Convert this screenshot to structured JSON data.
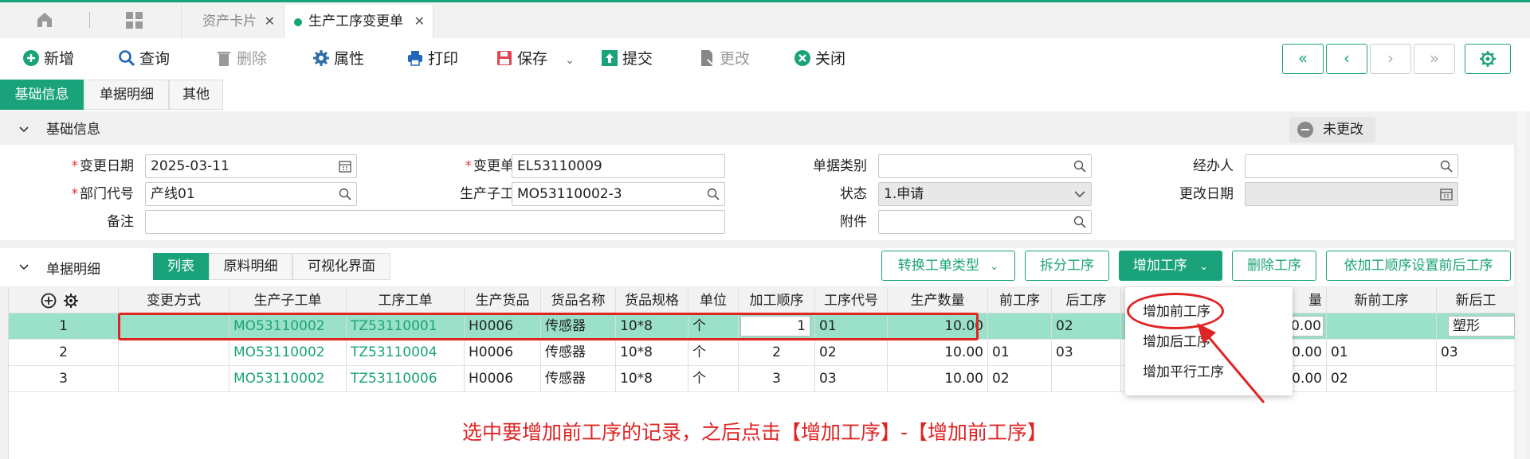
{
  "top_tabs": [
    {
      "label": "资产卡片"
    },
    {
      "label": "生产工序变更单"
    }
  ],
  "toolbar": {
    "add": "新增",
    "query": "查询",
    "delete": "删除",
    "properties": "属性",
    "print": "打印",
    "save": "保存",
    "submit": "提交",
    "modify": "更改",
    "close": "关闭"
  },
  "nav": {
    "first": "«",
    "prev": "‹",
    "next": "›",
    "last": "»"
  },
  "section_tabs": [
    "基础信息",
    "单据明细",
    "其他"
  ],
  "basic": {
    "title": "基础信息",
    "status": "未更改",
    "fields": {
      "change_date_label": "变更日期",
      "change_date": "2025-03-11",
      "change_no_label": "变更单号",
      "change_no": "EL53110009",
      "doc_type_label": "单据类别",
      "doc_type": "",
      "handler_label": "经办人",
      "handler": "",
      "dept_label": "部门代号",
      "dept": "产线01",
      "sub_order_label": "生产子工单",
      "sub_order": "MO53110002-3",
      "state_label": "状态",
      "state": "1.申请",
      "change_time_label": "更改日期",
      "change_time": "",
      "remark_label": "备注",
      "remark": "",
      "attachment_label": "附件",
      "attachment": ""
    },
    "required_mark": "*"
  },
  "detail": {
    "title": "单据明细",
    "tabs": [
      "列表",
      "原料明细",
      "可视化界面"
    ],
    "actions": {
      "convert": "转换工单类型",
      "split": "拆分工序",
      "add": "增加工序",
      "remove": "删除工序",
      "set_by_order": "依加工顺序设置前后工序"
    },
    "columns": [
      "变更方式",
      "生产子工单",
      "工序工单",
      "生产货品",
      "货品名称",
      "货品规格",
      "单位",
      "加工顺序",
      "工序代号",
      "生产数量",
      "前工序",
      "后工序",
      "量",
      "新前工序",
      "新后工"
    ],
    "rows": [
      {
        "idx": "1",
        "change": "",
        "sub_order": "MO53110002",
        "proc_order": "TZ53110001",
        "product": "H0006",
        "name": "传感器",
        "spec": "10*8",
        "unit": "个",
        "seq": "1",
        "code": "01",
        "qty": "10.00",
        "prev": "",
        "next": "02",
        "amt": "0.00",
        "new_prev": "",
        "new_next": "塑形"
      },
      {
        "idx": "2",
        "change": "",
        "sub_order": "MO53110002",
        "proc_order": "TZ53110004",
        "product": "H0006",
        "name": "传感器",
        "spec": "10*8",
        "unit": "个",
        "seq": "2",
        "code": "02",
        "qty": "10.00",
        "prev": "01",
        "next": "03",
        "amt": "0.00",
        "new_prev": "01",
        "new_next": "03"
      },
      {
        "idx": "3",
        "change": "",
        "sub_order": "MO53110002",
        "proc_order": "TZ53110006",
        "product": "H0006",
        "name": "传感器",
        "spec": "10*8",
        "unit": "个",
        "seq": "3",
        "code": "03",
        "qty": "10.00",
        "prev": "02",
        "next": "",
        "amt": "0.00",
        "new_prev": "02",
        "new_next": ""
      }
    ],
    "dropdown": [
      "增加前工序",
      "增加后工序",
      "增加平行工序"
    ]
  },
  "annotation": "选中要增加前工序的记录，之后点击【增加工序】-【增加前工序】",
  "colors": {
    "accent": "#1aa37a",
    "highlight": "#e02424",
    "selected_row": "#9be0c9"
  }
}
